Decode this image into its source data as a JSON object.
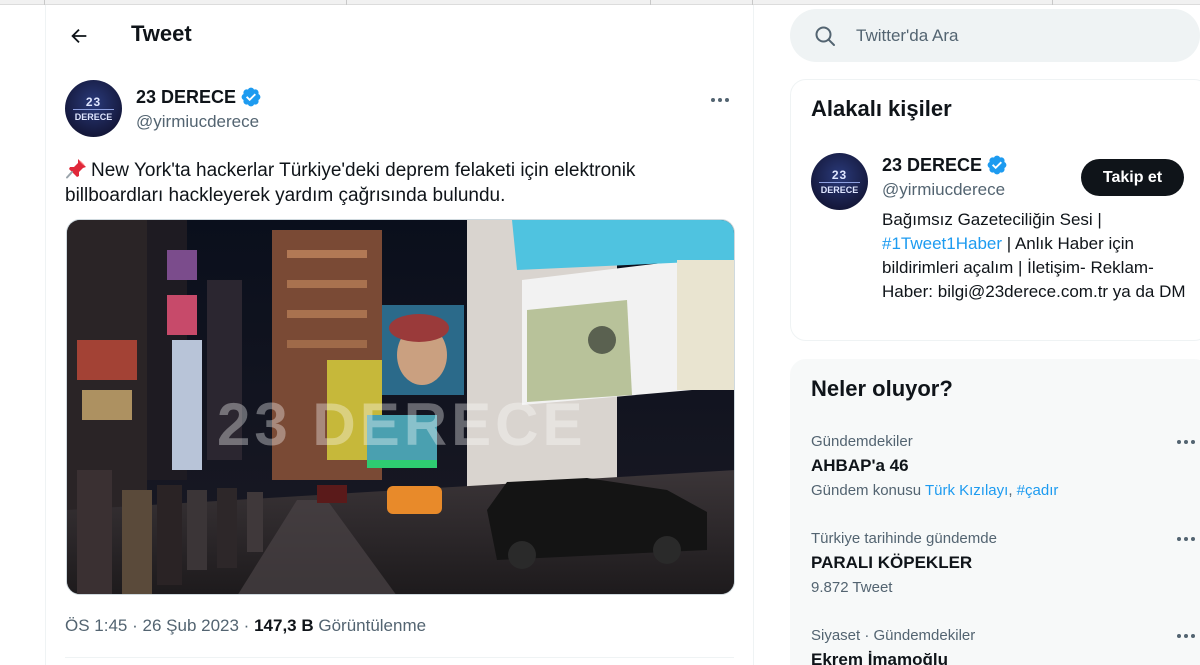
{
  "header": {
    "title": "Tweet"
  },
  "tweet": {
    "author_name": "23 DERECE",
    "author_handle": "@yirmiucderece",
    "avatar_text_top": "23",
    "avatar_text_bottom": "DERECE",
    "text": "New York'ta hackerlar Türkiye'deki deprem felaketi için elektronik billboardları hackleyerek yardım çağrısında bulundu.",
    "media_watermark": "23 DERECE",
    "time": "ÖS 1:45",
    "separator": "·",
    "date": "26 Şub 2023",
    "views_count": "147,3 B",
    "views_label": "Görüntülenme"
  },
  "search": {
    "placeholder": "Twitter'da Ara"
  },
  "related_people": {
    "title": "Alakalı kişiler",
    "person": {
      "name": "23 DERECE",
      "handle": "@yirmiucderece",
      "follow_label": "Takip et",
      "bio_part1": "Bağımsız Gazeteciliğin Sesi | ",
      "bio_link": "#1Tweet1Haber",
      "bio_part2": " | Anlık Haber için bildirimleri açalım | İletişim- Reklam- Haber: bilgi@23derece.com.tr ya da DM"
    }
  },
  "trends": {
    "title": "Neler oluyor?",
    "items": [
      {
        "context": "Gündemdekiler",
        "title": "AHBAP'a 46",
        "sub_prefix": "Gündem konusu ",
        "sub_link1": "Türk Kızılayı",
        "sub_sep": ", ",
        "sub_link2": "#çadır"
      },
      {
        "context": "Türkiye tarihinde gündemde",
        "title": "PARALI KÖPEKLER",
        "sub": "9.872 Tweet"
      },
      {
        "context": "Siyaset · Gündemdekiler",
        "title": "Ekrem İmamoğlu"
      }
    ]
  },
  "colors": {
    "accent": "#1d9bf0",
    "text_primary": "#0f1419",
    "text_secondary": "#536471",
    "button_dark": "#0f1419"
  },
  "icons": {
    "back": "arrow-left-icon",
    "verified": "verified-badge-icon",
    "more": "more-dots-icon",
    "pin": "pushpin-icon",
    "search": "search-icon"
  }
}
